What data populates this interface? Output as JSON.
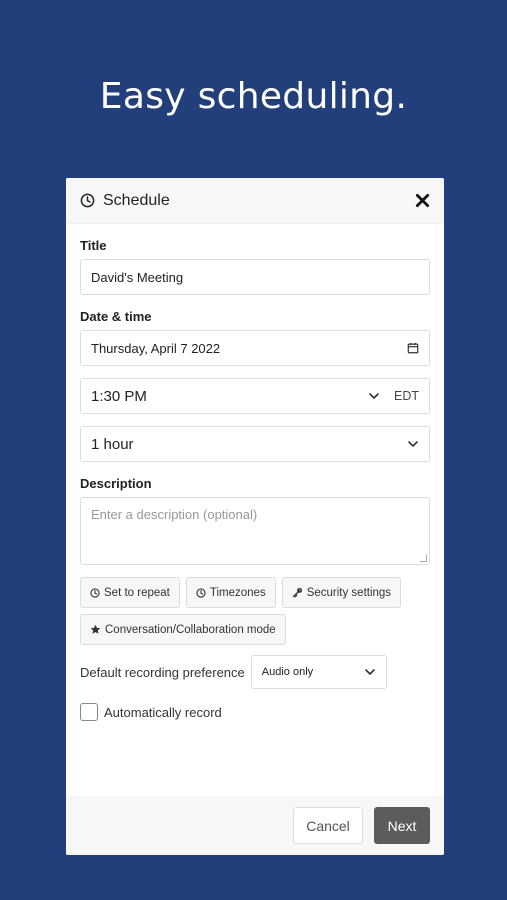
{
  "headline": "Easy scheduling.",
  "dialog": {
    "title": "Schedule",
    "title_label": "Title",
    "title_value": "David's Meeting",
    "datetime_label": "Date & time",
    "date_value": "Thursday, April 7 2022",
    "time_value": "1:30 PM",
    "timezone": "EDT",
    "duration_value": "1 hour",
    "description_label": "Description",
    "description_placeholder": "Enter a description (optional)",
    "options": {
      "repeat": "Set to repeat",
      "timezones": "Timezones",
      "security": "Security settings",
      "mode": "Conversation/Collaboration mode"
    },
    "recording_label": "Default recording preference",
    "recording_value": "Audio only",
    "auto_record_label": "Automatically record",
    "cancel_label": "Cancel",
    "next_label": "Next"
  },
  "colors": {
    "background": "#213f7a",
    "primary_button": "#5c5c5c"
  }
}
